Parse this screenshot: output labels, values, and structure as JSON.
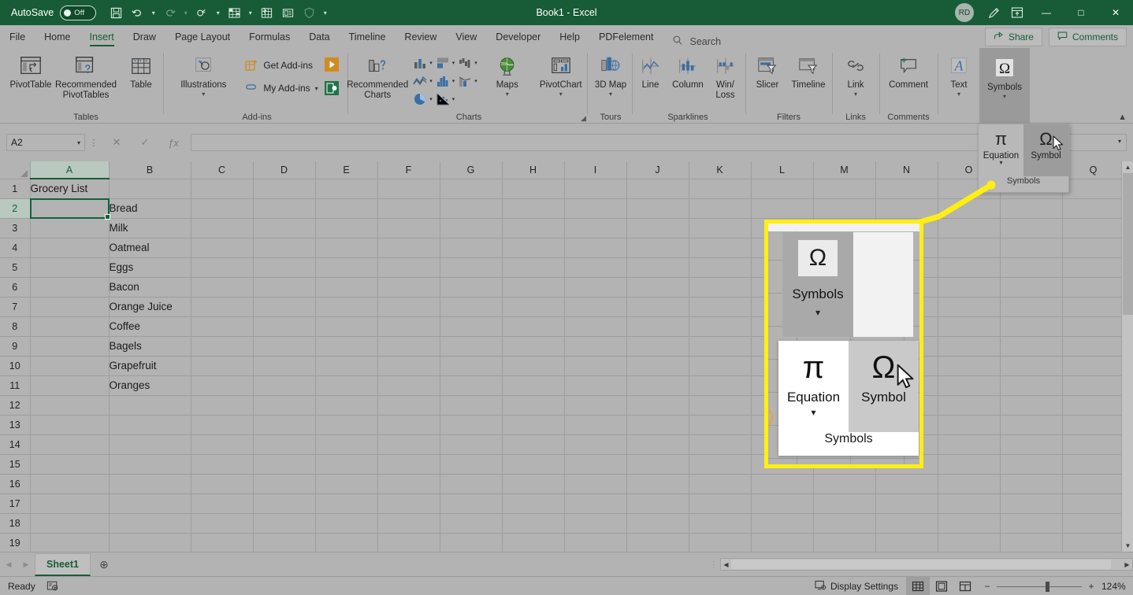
{
  "titlebar": {
    "autosave_label": "AutoSave",
    "autosave_state": "Off",
    "title": "Book1  -  Excel",
    "avatar_initials": "RD",
    "minimize": "—",
    "maximize": "□",
    "close": "✕",
    "qat": [
      {
        "name": "save-icon",
        "glyph": "💾"
      },
      {
        "name": "undo-icon",
        "glyph": "↶"
      },
      {
        "name": "redo-icon",
        "glyph": "↷"
      },
      {
        "name": "touch-mode-icon",
        "glyph": "☝"
      },
      {
        "name": "new-sheet-icon",
        "glyph": "▦"
      },
      {
        "name": "quick-table-icon",
        "glyph": "▤"
      },
      {
        "name": "form-icon",
        "glyph": "▣"
      },
      {
        "name": "shield-icon",
        "glyph": "⬤"
      },
      {
        "name": "customize-qat-icon",
        "glyph": "⌄"
      }
    ]
  },
  "tabs": {
    "items": [
      "File",
      "Home",
      "Insert",
      "Draw",
      "Page Layout",
      "Formulas",
      "Data",
      "Timeline",
      "Review",
      "View",
      "Developer",
      "Help",
      "PDFelement"
    ],
    "active": "Insert",
    "search_placeholder": "Search",
    "share_label": "Share",
    "comments_label": "Comments"
  },
  "ribbon": {
    "groups": [
      {
        "name": "Tables",
        "buttons": [
          "PivotTable",
          "Recommended PivotTables",
          "Table"
        ]
      },
      {
        "name": "Add-ins",
        "big": "Illustrations",
        "small": [
          "Get Add-ins",
          "My Add-ins"
        ]
      },
      {
        "name": "Charts",
        "buttons": [
          "Recommended Charts",
          "Maps",
          "PivotChart"
        ]
      },
      {
        "name": "Tours",
        "buttons": [
          "3D Map"
        ]
      },
      {
        "name": "Sparklines",
        "buttons": [
          "Line",
          "Column",
          "Win/ Loss"
        ]
      },
      {
        "name": "Filters",
        "buttons": [
          "Slicer",
          "Timeline"
        ]
      },
      {
        "name": "Links",
        "buttons": [
          "Link"
        ]
      },
      {
        "name": "Comments",
        "buttons": [
          "Comment"
        ]
      },
      {
        "name": "",
        "buttons": [
          "Text",
          "Symbols"
        ]
      }
    ],
    "labels": {
      "pivottable": "PivotTable",
      "recommended_pivottables": "Recommended PivotTables",
      "table": "Table",
      "illustrations": "Illustrations",
      "get_addins": "Get Add-ins",
      "my_addins": "My Add-ins",
      "recommended_charts": "Recommended Charts",
      "maps": "Maps",
      "pivotchart": "PivotChart",
      "map3d": "3D Map",
      "line": "Line",
      "column": "Column",
      "winloss": "Win/ Loss",
      "slicer": "Slicer",
      "timeline": "Timeline",
      "link": "Link",
      "comment": "Comment",
      "text": "Text",
      "symbols": "Symbols",
      "g_tables": "Tables",
      "g_addins": "Add-ins",
      "g_charts": "Charts",
      "g_tours": "Tours",
      "g_sparklines": "Sparklines",
      "g_filters": "Filters",
      "g_links": "Links",
      "g_comments": "Comments"
    }
  },
  "formula_bar": {
    "name_box_value": "A2",
    "cancel_icon": "✕",
    "enter_icon": "✓",
    "fx_icon": "ƒx",
    "formula_value": ""
  },
  "grid": {
    "columns": [
      "A",
      "B",
      "C",
      "D",
      "E",
      "F",
      "G",
      "H",
      "I",
      "J",
      "K",
      "L",
      "M",
      "N",
      "O",
      "P",
      "Q"
    ],
    "selected_column": "A",
    "selected_row": 2,
    "rows": [
      {
        "n": 1,
        "a": "Grocery List",
        "b": ""
      },
      {
        "n": 2,
        "a": "",
        "b": "Bread"
      },
      {
        "n": 3,
        "a": "",
        "b": "Milk"
      },
      {
        "n": 4,
        "a": "",
        "b": "Oatmeal"
      },
      {
        "n": 5,
        "a": "",
        "b": "Eggs"
      },
      {
        "n": 6,
        "a": "",
        "b": "Bacon"
      },
      {
        "n": 7,
        "a": "",
        "b": "Orange Juice"
      },
      {
        "n": 8,
        "a": "",
        "b": "Coffee"
      },
      {
        "n": 9,
        "a": "",
        "b": "Bagels"
      },
      {
        "n": 10,
        "a": "",
        "b": "Grapefruit"
      },
      {
        "n": 11,
        "a": "",
        "b": "Oranges"
      },
      {
        "n": 12,
        "a": "",
        "b": ""
      },
      {
        "n": 13,
        "a": "",
        "b": ""
      },
      {
        "n": 14,
        "a": "",
        "b": ""
      },
      {
        "n": 15,
        "a": "",
        "b": ""
      },
      {
        "n": 16,
        "a": "",
        "b": ""
      },
      {
        "n": 17,
        "a": "",
        "b": ""
      },
      {
        "n": 18,
        "a": "",
        "b": ""
      },
      {
        "n": 19,
        "a": "",
        "b": ""
      }
    ]
  },
  "symbols_dropdown": {
    "equation_label": "Equation",
    "symbol_label": "Symbol",
    "group_label": "Symbols",
    "equation_glyph": "π",
    "symbol_glyph": "Ω"
  },
  "callout": {
    "ribbon_button_label": "Symbols",
    "ribbon_button_glyph": "Ω",
    "equation_label": "Equation",
    "equation_glyph": "π",
    "symbol_label": "Symbol",
    "symbol_glyph": "Ω",
    "group_label": "Symbols",
    "border_color": "#ffee12"
  },
  "sheet_tabs": {
    "prev": "◀",
    "next": "▶",
    "tabs": [
      "Sheet1"
    ],
    "active": "Sheet1",
    "add_label": "⊕"
  },
  "status_bar": {
    "status": "Ready",
    "accessibility_icon": "accessibility-checker-icon",
    "display_settings": "Display Settings",
    "views": [
      "normal-view",
      "page-layout-view",
      "page-break-view"
    ],
    "active_view": "normal-view",
    "zoom_out": "−",
    "zoom_in": "+",
    "zoom_value": "124%"
  },
  "colors": {
    "excel_green": "#185c37",
    "ribbon_gray": "#b3b3b3",
    "highlight_yellow": "#ffee12",
    "selection_green": "#13623c"
  }
}
